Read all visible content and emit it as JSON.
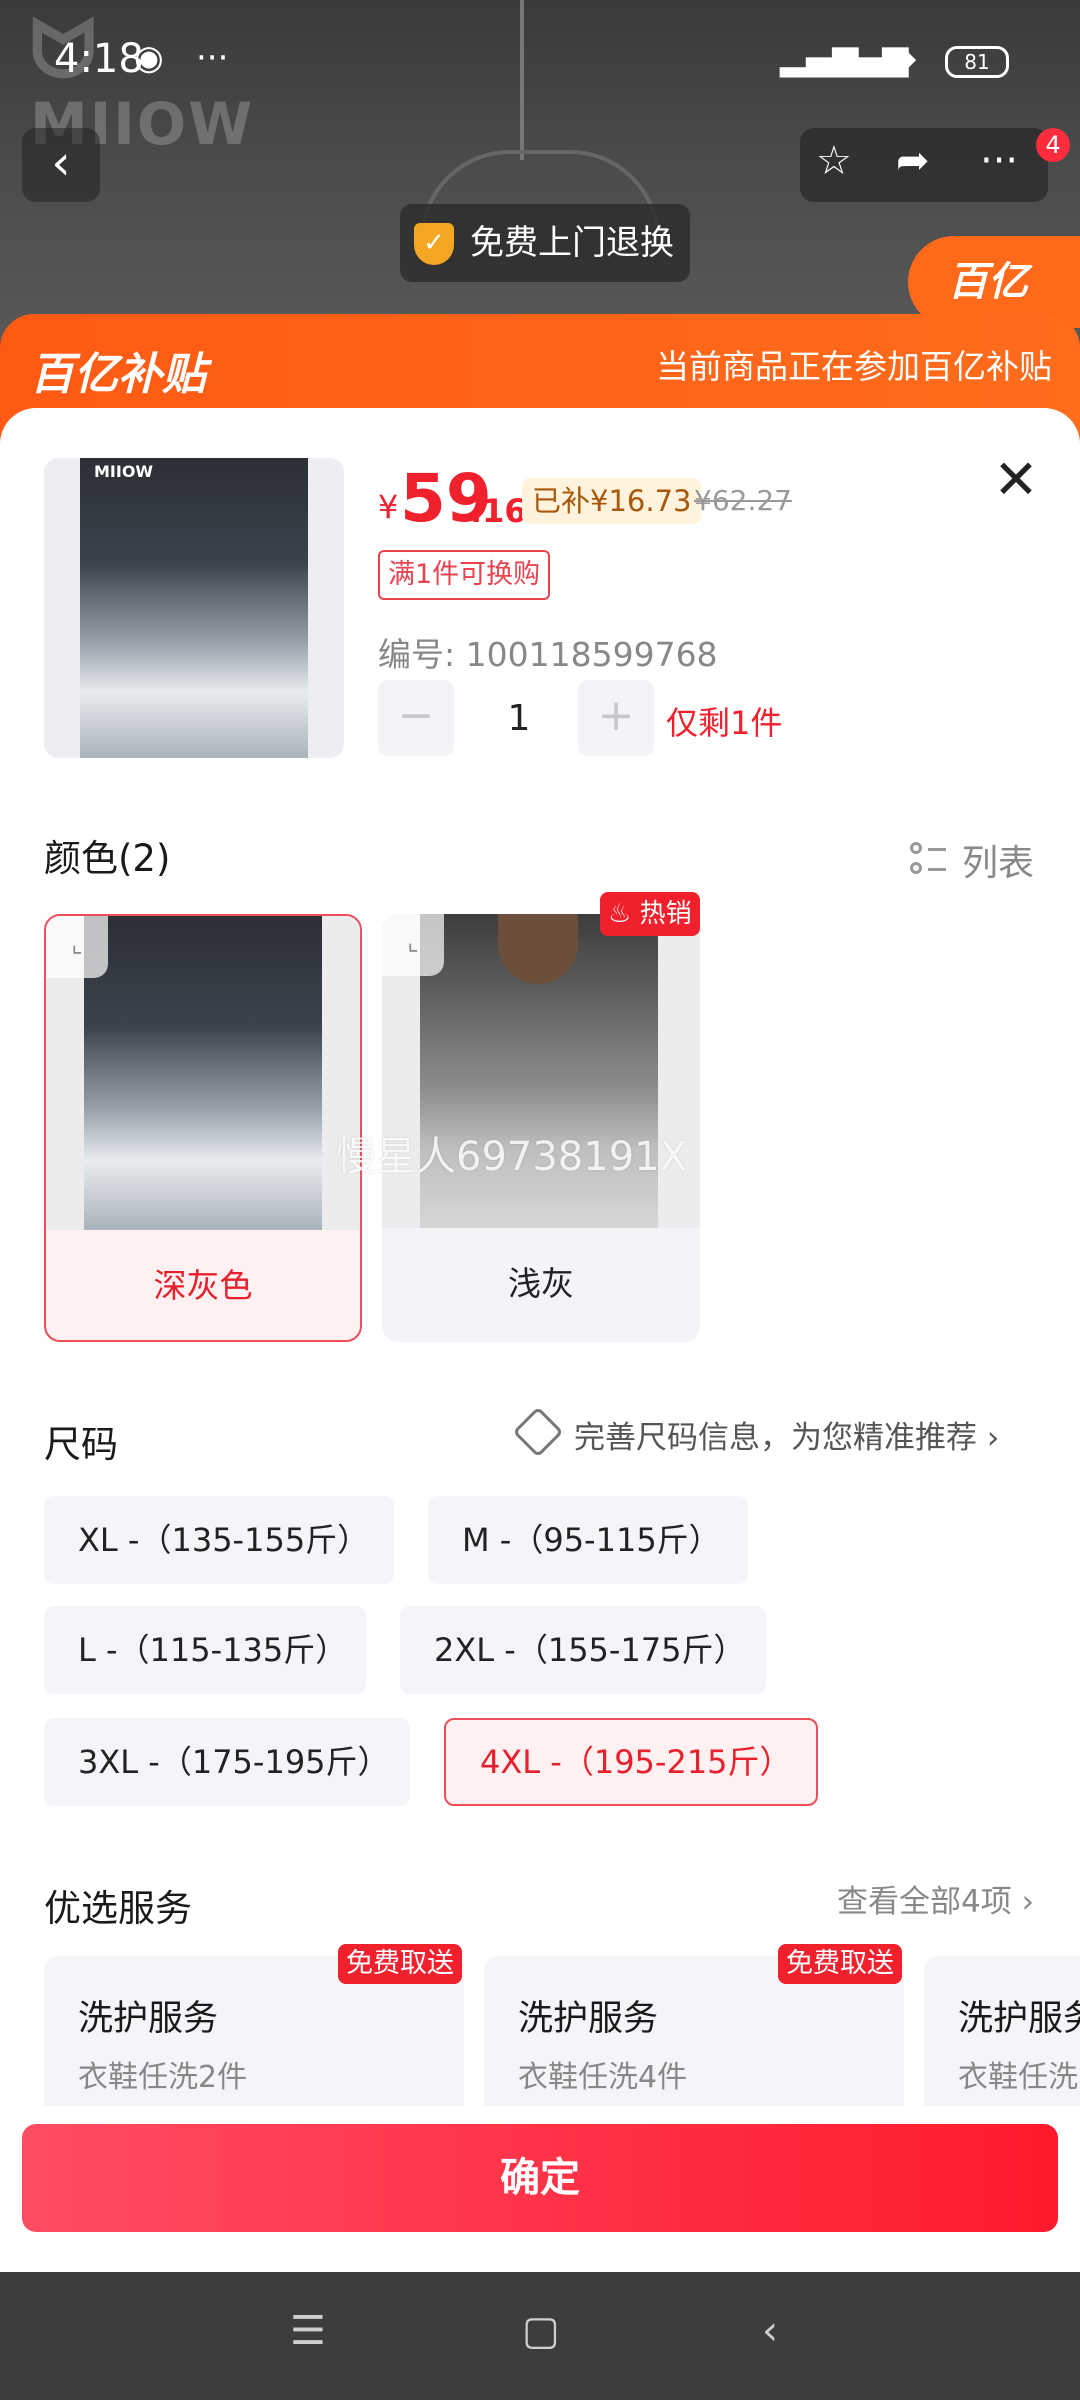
{
  "status_bar": {
    "time": "4:18",
    "more": "···",
    "battery": "81"
  },
  "header": {
    "brand_watermark": "MIIOW",
    "free_return": "免费上门退换",
    "cart_count": "4",
    "bybt_badge": "百亿"
  },
  "subsidy_bar": {
    "logo": "百亿补贴",
    "text": "当前商品正在参加百亿补贴"
  },
  "product": {
    "thumb_logo": "MIIOW",
    "currency": "¥",
    "price_int": "59",
    "price_dec": ".16",
    "subsidy": "已补¥16.73",
    "original_price": "¥62.27",
    "tag": "满1件可换购",
    "sku_id": "编号: 100118599768",
    "quantity": "1",
    "stock": "仅剩1件",
    "minus": "−",
    "plus": "+"
  },
  "color_section": {
    "title": "颜色(2)",
    "list_view": "列表",
    "hot_badge": "热销",
    "watermark": "慢星人69738191X",
    "options": [
      {
        "label": "深灰色",
        "selected": true
      },
      {
        "label": "浅灰",
        "selected": false
      }
    ]
  },
  "size_section": {
    "title": "尺码",
    "tip": "完善尺码信息，为您精准推荐",
    "options": [
      {
        "label": "XL -（135-155斤）",
        "selected": false
      },
      {
        "label": "M -（95-115斤）",
        "selected": false
      },
      {
        "label": "L -（115-135斤）",
        "selected": false
      },
      {
        "label": "2XL -（155-175斤）",
        "selected": false
      },
      {
        "label": "3XL -（175-195斤）",
        "selected": false
      },
      {
        "label": "4XL -（195-215斤）",
        "selected": true
      }
    ]
  },
  "service_section": {
    "title": "优选服务",
    "view_all": "查看全部4项",
    "items": [
      {
        "name": "洗护服务",
        "sub": "衣鞋任洗2件",
        "badge": "免费取送"
      },
      {
        "name": "洗护服务",
        "sub": "衣鞋任洗4件",
        "badge": "免费取送"
      },
      {
        "name": "洗护服务",
        "sub": "衣鞋任洗",
        "badge": ""
      }
    ]
  },
  "confirm_button": "确定",
  "colors": {
    "accent": "#f0202c",
    "subsidy_orange": "#ff5a14",
    "selected_bg": "#fff0f2"
  }
}
